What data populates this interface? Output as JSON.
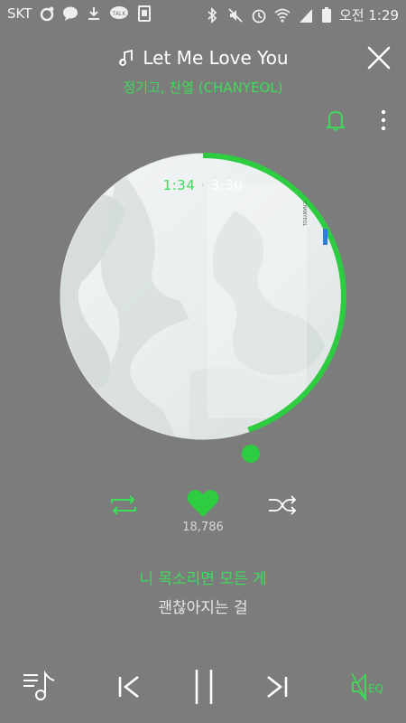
{
  "status_bar": {
    "carrier": "SKT",
    "time": "오전 1:29",
    "icons": [
      "circle-app-icon",
      "chat-icon",
      "download-icon",
      "talk-icon",
      "document-icon",
      "bluetooth-icon",
      "mute-icon",
      "alarm-icon",
      "wifi-icon",
      "signal-icon",
      "battery-icon"
    ]
  },
  "header": {
    "song_title": "Let Me Love You",
    "artist": "정기고, 찬열 (CHANYEOL)"
  },
  "disc": {
    "elapsed": "1:34",
    "separator": "·",
    "duration": "3:30",
    "progress_fraction": 0.4476
  },
  "controls": {
    "like_count": "18,786"
  },
  "lyrics": {
    "current": "니 목소리면 모든 게",
    "next": "괜찮아지는 걸"
  },
  "colors": {
    "accent": "#3ddc5a",
    "background": "#7b7c7b",
    "text": "#ffffff"
  }
}
